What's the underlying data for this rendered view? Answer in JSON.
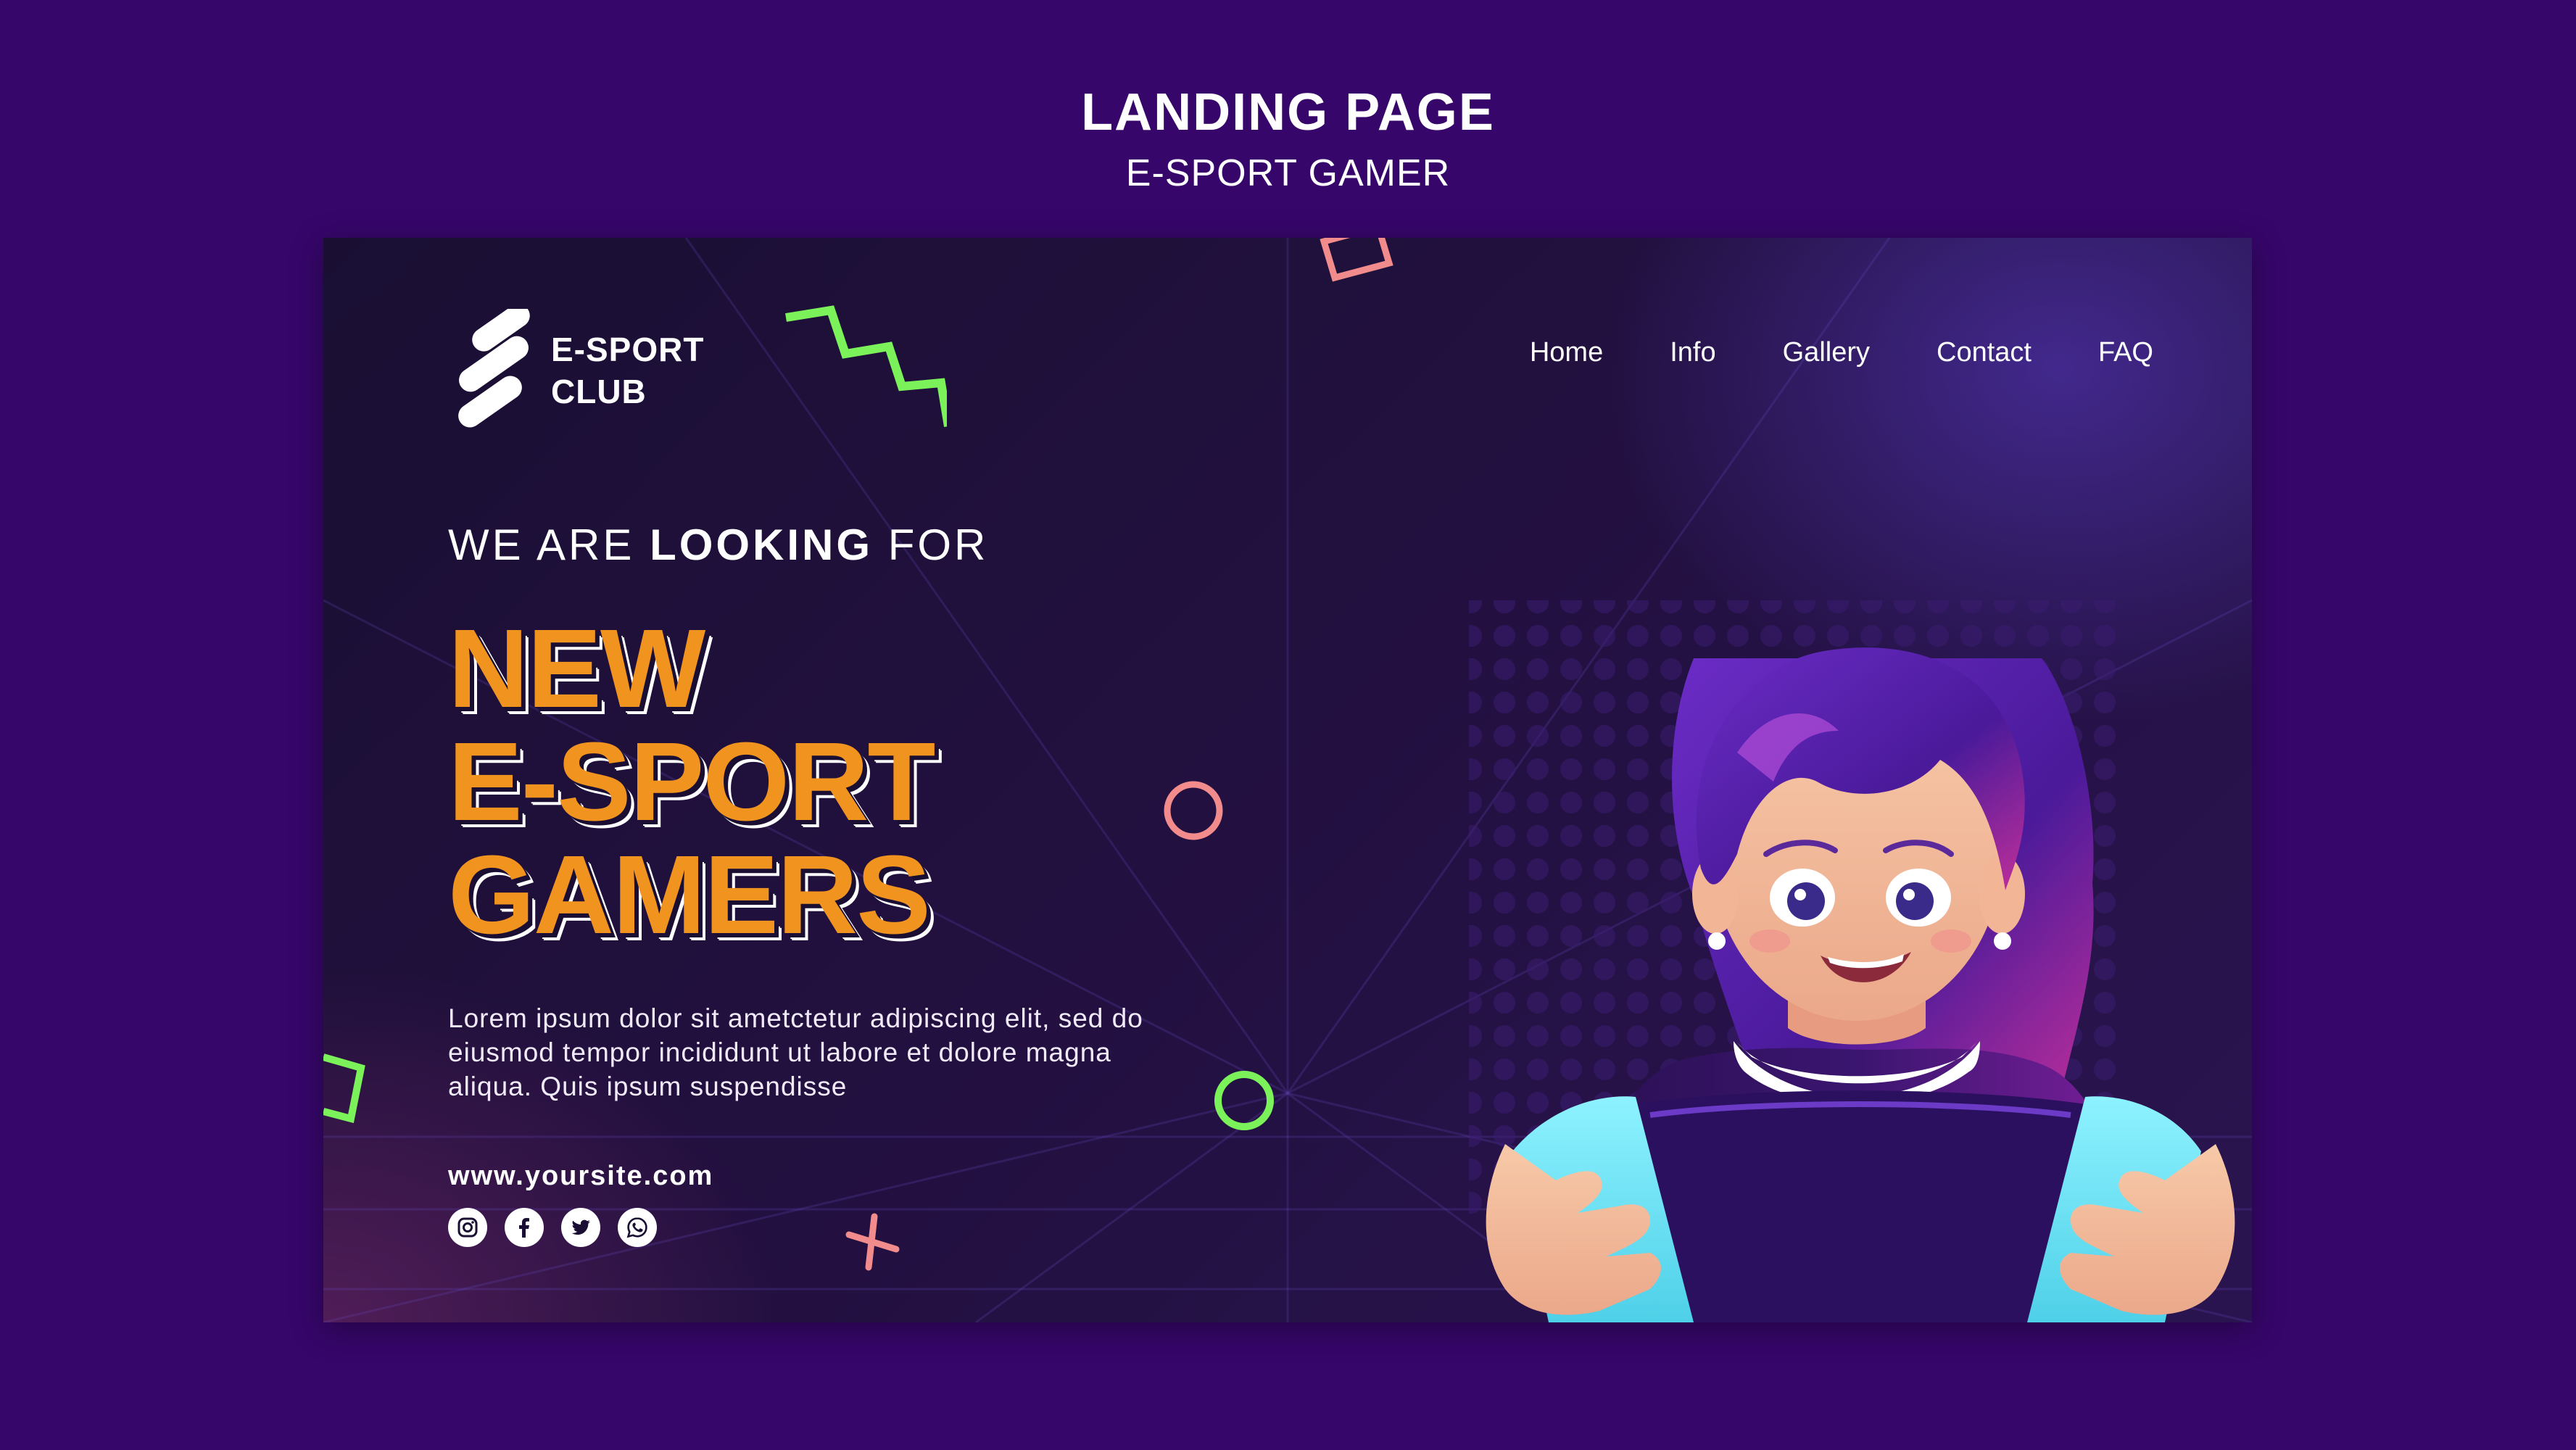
{
  "page_header": {
    "title": "LANDING PAGE",
    "subtitle": "E-SPORT GAMER"
  },
  "logo": {
    "line1": "E-SPORT",
    "line2": "CLUB"
  },
  "nav": {
    "items": [
      {
        "label": "Home"
      },
      {
        "label": "Info"
      },
      {
        "label": "Gallery"
      },
      {
        "label": "Contact"
      },
      {
        "label": "FAQ"
      }
    ]
  },
  "hero": {
    "tagline_pre": "WE ARE ",
    "tagline_bold": "LOOKING",
    "tagline_post": " FOR",
    "headline_lines": [
      "NEW",
      "E-SPORT",
      "GAMERS"
    ],
    "body": "Lorem ipsum dolor sit ametctetur adipiscing elit, sed do eiusmod tempor incididunt ut labore et dolore magna aliqua. Quis ipsum suspendisse",
    "website": "www.yoursite.com"
  },
  "socials": [
    "instagram-icon",
    "facebook-icon",
    "twitter-icon",
    "whatsapp-icon"
  ],
  "colors": {
    "page_background": "#36066a",
    "card_background": "#1a0f33",
    "headline_orange": "#f0931f",
    "accent_green": "#7cf25a",
    "accent_pink": "#f28c8c",
    "hair_purple": "#5b1fb3",
    "sleeve_cyan": "#6ee8f5",
    "text_white": "#ffffff"
  }
}
